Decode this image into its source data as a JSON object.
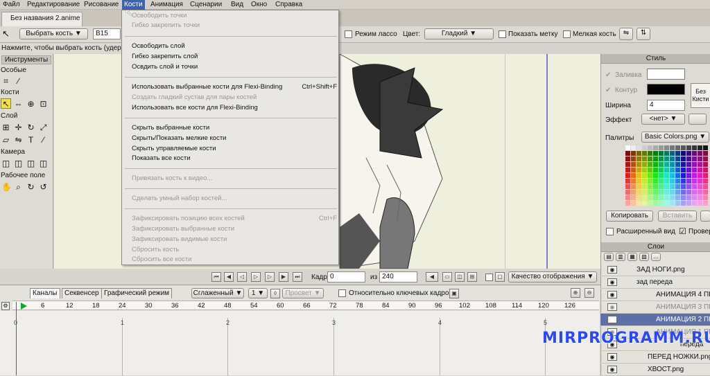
{
  "menubar": {
    "items": [
      "Файл",
      "Редактирование",
      "Рисование",
      "Кости",
      "Анимация",
      "Сценарии",
      "Вид",
      "Окно",
      "Справка"
    ],
    "active": "Кости"
  },
  "document_tab": "Без названия 2.anime",
  "tool_options": {
    "select_bone_label": "Выбрать кость",
    "bone_field_value": "B15",
    "lasso_label": "Режим лассо",
    "color_label": "Цвет:",
    "color_value": "Гладкий",
    "show_label_label": "Показать метку",
    "small_bone_label": "Мелкая кость"
  },
  "status_hint": "Нажмите, чтобы выбрать кость (удержи",
  "toolbox": {
    "title": "Инструменты",
    "sections": [
      "Особые",
      "Кости",
      "Слой",
      "Камера",
      "Рабочее поле"
    ]
  },
  "bones_menu": {
    "items": [
      {
        "label": "Освободить точки",
        "enabled": false,
        "shortcut": ""
      },
      {
        "label": "Гибко закрепить точки",
        "enabled": false,
        "shortcut": ""
      },
      {
        "label": "Освободить слой",
        "enabled": true,
        "shortcut": ""
      },
      {
        "label": "Гибко закрепить слой",
        "enabled": true,
        "shortcut": ""
      },
      {
        "label": "Освдить слой и точки",
        "enabled": true,
        "shortcut": ""
      },
      {
        "label": "Использовать выбранные кости для Flexi-Binding",
        "enabled": true,
        "shortcut": "Ctrl+Shift+F"
      },
      {
        "label": "Создать гладкий сустав для пары костей",
        "enabled": false,
        "shortcut": ""
      },
      {
        "label": "Использовать все кости для Flexi-Binding",
        "enabled": true,
        "shortcut": ""
      },
      {
        "label": "Скрыть выбранные кости",
        "enabled": true,
        "shortcut": ""
      },
      {
        "label": "Скрыть/Показать мелкие кости",
        "enabled": true,
        "shortcut": ""
      },
      {
        "label": "Скрыть управляемые кости",
        "enabled": true,
        "shortcut": ""
      },
      {
        "label": "Показать все кости",
        "enabled": true,
        "shortcut": ""
      },
      {
        "label": "Привязать кость к видео...",
        "enabled": false,
        "shortcut": ""
      },
      {
        "label": "Сделать умный набор костей...",
        "enabled": false,
        "shortcut": ""
      },
      {
        "label": "Зафиксировать позицию всех костей",
        "enabled": false,
        "shortcut": "Ctrl+F"
      },
      {
        "label": "Зафиксировать выбранные кости",
        "enabled": false,
        "shortcut": ""
      },
      {
        "label": "Зафиксировать видимые кости",
        "enabled": false,
        "shortcut": ""
      },
      {
        "label": "Сбросить кость",
        "enabled": false,
        "shortcut": ""
      },
      {
        "label": "Сбросить все кости",
        "enabled": false,
        "shortcut": ""
      }
    ]
  },
  "transport": {
    "frame_label": "Кадр",
    "frame_value": "0",
    "of_label": "из",
    "total_frames": "240",
    "quality_label": "Качество отображения"
  },
  "timeline": {
    "tabs": [
      "Каналы",
      "Секвенсер",
      "Графический режим"
    ],
    "interp_value": "Сглаженный",
    "step_value": "1",
    "preview_label": "Просвет",
    "relative_label": "Относительно ключевых кадров",
    "ruler": [
      "6",
      "12",
      "18",
      "24",
      "30",
      "36",
      "42",
      "48",
      "54",
      "60",
      "66",
      "72",
      "78",
      "84",
      "90",
      "96",
      "102",
      "108",
      "114",
      "120",
      "126"
    ],
    "markers": [
      "0",
      "1",
      "2",
      "3",
      "4",
      "5"
    ]
  },
  "style_panel": {
    "title": "Стиль",
    "fill_label": "Заливка",
    "stroke_label": "Контур",
    "width_label": "Ширина",
    "width_value": "4",
    "effect_label": "Эффект",
    "effect_value": "<нет>",
    "no_brush_label": "Без Кисти",
    "palettes_label": "Палитры",
    "palette_value": "Basic Colors.png",
    "copy_label": "Копировать",
    "paste_label": "Вставить",
    "extended_label": "Расширенный вид",
    "check_label": "Провер",
    "fill_color": "#ffffff",
    "stroke_color": "#000000"
  },
  "layers_panel": {
    "title": "Слои",
    "rows": [
      "ЗАД НОГИ.png",
      "зад переда",
      "АНИМАЦИЯ 4 ПЕ",
      "АНИМАЦИЯ 3 ПЕ",
      "АНИМАЦИЯ 2 ПЕ",
      "АНИМАЦИЯ 1 ПЕ",
      "переда",
      "ПЕРЕД НОЖКИ.png",
      "ХВОСТ.png"
    ]
  },
  "watermark": "MIRPROGRAMM.RU"
}
